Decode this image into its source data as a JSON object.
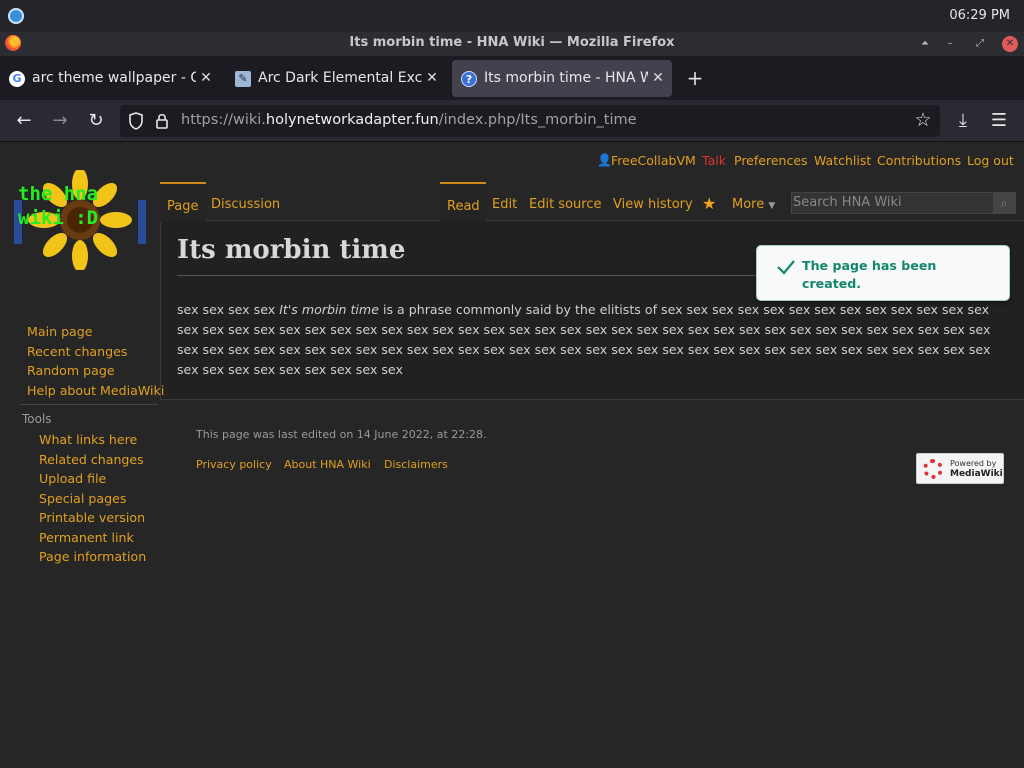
{
  "os": {
    "clock": "06:29 PM"
  },
  "window": {
    "title": "Its morbin time - HNA Wiki — Mozilla Firefox"
  },
  "tabs": [
    {
      "label": "arc theme wallpaper - Go",
      "favicon": "google-icon"
    },
    {
      "label": "Arc Dark Elemental Exclu",
      "favicon": "wallpaper-site-icon"
    },
    {
      "label": "Its morbin time - HNA Wi",
      "favicon": "mediawiki-icon",
      "active": true
    }
  ],
  "nav": {
    "url_prefix": "https://wiki.",
    "url_domain": "holynetworkadapter.fun",
    "url_path": "/index.php/Its_morbin_time"
  },
  "personal_tools": [
    {
      "label": "FreeCollabVM",
      "id": "user"
    },
    {
      "label": "Talk",
      "id": "talk",
      "color": "#dd3333"
    },
    {
      "label": "Preferences",
      "id": "preferences"
    },
    {
      "label": "Watchlist",
      "id": "watchlist"
    },
    {
      "label": "Contributions",
      "id": "contributions"
    },
    {
      "label": "Log out",
      "id": "logout"
    }
  ],
  "logo": {
    "text_line1": "the hna",
    "text_line2": "wiki :D"
  },
  "namespace_tabs": {
    "page": "Page",
    "discussion": "Discussion"
  },
  "view_tabs": {
    "read": "Read",
    "edit": "Edit",
    "edit_source": "Edit source",
    "history": "View history",
    "more": "More"
  },
  "search": {
    "placeholder": "Search HNA Wiki"
  },
  "article": {
    "title": "Its morbin time",
    "lead": "sex sex sex sex ",
    "italic": "It's morbin time",
    "body": " is a phrase commonly said by the elitists of sex sex sex sex sex sex sex sex sex sex sex sex sex sex sex sex sex sex sex sex sex sex sex sex sex sex sex sex sex sex sex sex sex sex sex sex sex sex sex sex sex sex sex sex sex sex sex sex sex sex sex sex sex sex sex sex sex sex sex sex sex sex sex sex sex sex sex sex sex sex sex sex sex sex sex sex sex sex sex sex sex sex sex sex sex sex"
  },
  "notification": {
    "text": "The page has been created."
  },
  "sidebar": {
    "nav": [
      "Main page",
      "Recent changes",
      "Random page",
      "Help about MediaWiki"
    ],
    "tools_heading": "Tools",
    "tools": [
      "What links here",
      "Related changes",
      "Upload file",
      "Special pages",
      "Printable version",
      "Permanent link",
      "Page information"
    ]
  },
  "footer": {
    "last_edited": "This page was last edited on 14 June 2022, at 22:28.",
    "links": [
      "Privacy policy",
      "About HNA Wiki",
      "Disclaimers"
    ],
    "powered_line1": "Powered by",
    "powered_line2": "MediaWiki"
  },
  "colors": {
    "link": "#e0a020",
    "talk_red": "#dd3333",
    "notif_green": "#14866d"
  }
}
